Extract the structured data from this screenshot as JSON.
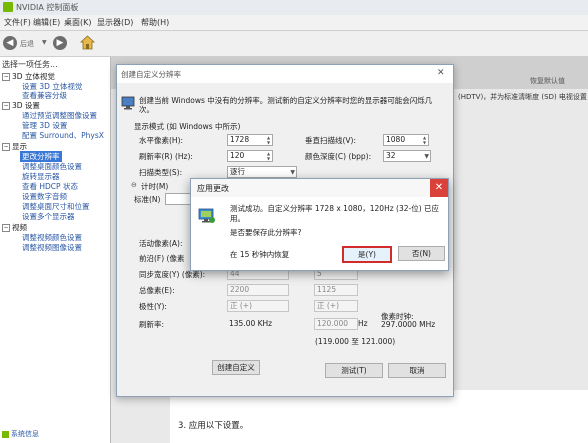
{
  "window": {
    "title": "NVIDIA 控制面板"
  },
  "menu": [
    "文件(F)",
    "编辑(E)",
    "桌面(K)",
    "显示器(D)",
    "帮助(H)"
  ],
  "toolbar": {
    "back_label": "后退"
  },
  "left_panel": {
    "header": "选择一项任务...",
    "tree": [
      {
        "text": "3D 立体视觉",
        "kind": "category",
        "toggle": "−"
      },
      {
        "text": "设置 3D 立体视觉",
        "kind": "leaf"
      },
      {
        "text": "查看兼容分级",
        "kind": "leaf"
      },
      {
        "text": "3D 设置",
        "kind": "category",
        "toggle": "−"
      },
      {
        "text": "通过预览调整图像设置",
        "kind": "leaf"
      },
      {
        "text": "管理 3D 设置",
        "kind": "leaf"
      },
      {
        "text": "配置 Surround、PhysX",
        "kind": "leaf"
      },
      {
        "text": "显示",
        "kind": "category",
        "toggle": "−"
      },
      {
        "text": "更改分辨率",
        "kind": "selected"
      },
      {
        "text": "调整桌面颜色设置",
        "kind": "leaf"
      },
      {
        "text": "旋转显示器",
        "kind": "leaf"
      },
      {
        "text": "查看 HDCP 状态",
        "kind": "leaf"
      },
      {
        "text": "设置数字音频",
        "kind": "leaf"
      },
      {
        "text": "调整桌面尺寸和位置",
        "kind": "leaf"
      },
      {
        "text": "设置多个显示器",
        "kind": "leaf"
      },
      {
        "text": "视频",
        "kind": "category",
        "toggle": "−"
      },
      {
        "text": "调整视频颜色设置",
        "kind": "leaf"
      },
      {
        "text": "调整视频图像设置",
        "kind": "leaf"
      }
    ],
    "system_info": "系统信息"
  },
  "right_panel": {
    "restore_default": "恢复默认值",
    "desc": "(HDTV)，并为标准清晰度 (SD) 电视设置",
    "section3": "3. 应用以下设置。"
  },
  "custom_res_dialog": {
    "title": "创建自定义分辨率",
    "header_text": "创建当前 Windows 中没有的分辨率。测试新的自定义分辨率时您的显示器可能会闪烁几次。",
    "display_mode_label": "显示模式 (如 Windows 中所示)",
    "h_pixels_label": "水平像素(H):",
    "h_pixels": "1728",
    "v_lines_label": "垂直扫描线(V):",
    "v_lines": "1080",
    "refresh_label": "刷新率(R) (Hz):",
    "refresh": "120",
    "color_depth_label": "颜色深度(C) (bpp):",
    "color_depth": "32",
    "scan_type_label": "扫描类型(S):",
    "scan_type": "逐行",
    "timing_label": "计时(M)",
    "standard_label": "标准(N)",
    "active_pixels_label": "活动像素(A):",
    "front_porch_label": "前沿(F) (像素",
    "sync_width_label": "同步宽度(Y) (像素):",
    "sync_width_h": "44",
    "sync_width_v": "5",
    "total_pixels_label": "总像素(E):",
    "total_pixels_h": "2200",
    "total_pixels_v": "1125",
    "polarity_label": "极性(Y):",
    "polarity_h": "正 (+)",
    "polarity_v": "正 (+)",
    "refresh_rate_label": "刷新率:",
    "refresh_khz": "135.00 KHz",
    "refresh_hz": "120.000",
    "hz_unit": "Hz",
    "pixel_clock_label": "像素时钟:",
    "pixel_clock": "297.0000 MHz",
    "range": "(119.000 至 121.000)",
    "test_button": "测试(T)",
    "cancel_button": "取消",
    "create_button": "创建自定义"
  },
  "apply_dialog": {
    "title": "应用更改",
    "message": "测试成功。自定义分辨率 1728 x 1080，120Hz (32-位) 已应用。",
    "question": "是否要保存此分辨率?",
    "countdown": "在 15 秒钟内恢复",
    "yes_button": "是(Y)",
    "no_button": "否(N)",
    "close": "✕"
  }
}
